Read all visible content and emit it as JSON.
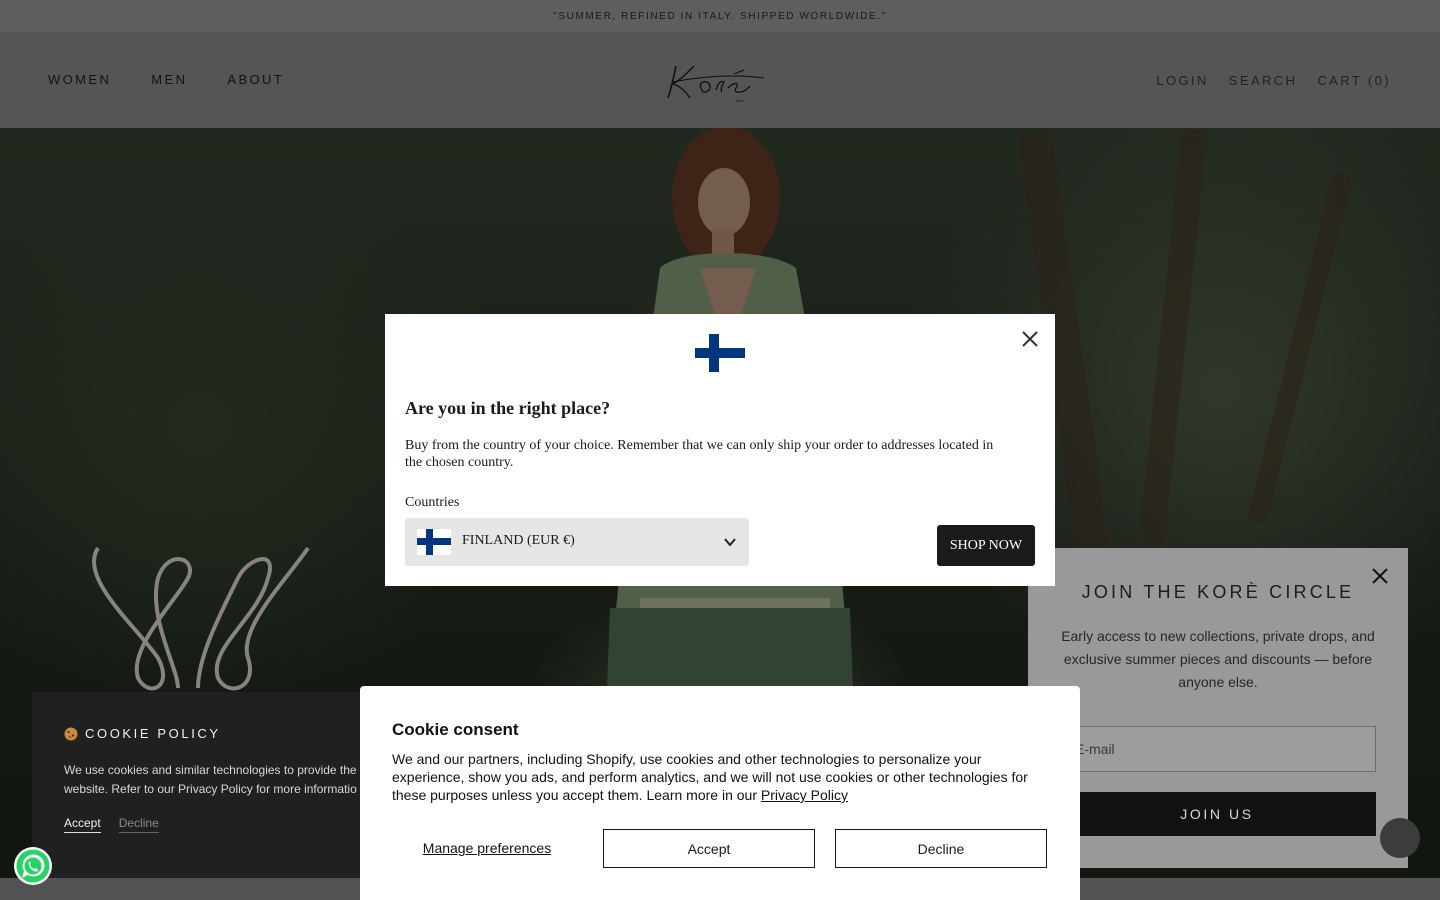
{
  "announcement": "\"Summer, refined in Italy. Shipped worldwide.\"",
  "header": {
    "nav_left": [
      "WOMEN",
      "MEN",
      "ABOUT"
    ],
    "login": "LOGIN",
    "search": "SEARCH",
    "cart": "CART (0)",
    "logo_text": "Korè"
  },
  "cookie_policy": {
    "icon": "cookie-icon",
    "title": "COOKIE POLICY",
    "text_line1": "We use cookies and similar technologies to provide the",
    "text_line2": "website. Refer to our Privacy Policy for more informatio",
    "accept": "Accept",
    "decline": "Decline"
  },
  "newsletter": {
    "title": "JOIN THE KORÈ CIRCLE",
    "text": "Early access to new collections, private drops, and exclusive summer pieces and discounts — before anyone else.",
    "email_placeholder": "E-mail",
    "button": "JOIN US",
    "close_icon": "close-icon"
  },
  "country_modal": {
    "flag": "finland-flag-icon",
    "title": "Are you in the right place?",
    "text": "Buy from the country of your choice. Remember that we can only ship your order to addresses located in the chosen country.",
    "label": "Countries",
    "selected_country": "FINLAND (EUR €)",
    "button": "SHOP NOW",
    "close_icon": "close-icon"
  },
  "cookie_consent": {
    "title": "Cookie consent",
    "text": "We and our partners, including Shopify, use cookies and other technologies to personalize your experience, show you ads, and perform analytics, and we will not use cookies or other technologies for these purposes unless you accept them. Learn more in our ",
    "privacy_link": "Privacy Policy",
    "manage": "Manage preferences",
    "accept": "Accept",
    "decline": "Decline"
  },
  "colors": {
    "finland_blue": "#003580",
    "dark_button": "#1b1b1b",
    "whatsapp_green": "#25D366"
  }
}
